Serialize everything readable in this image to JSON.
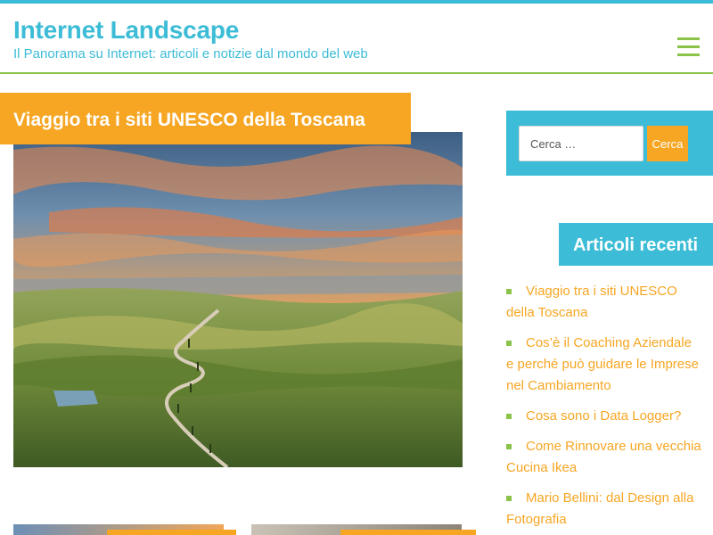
{
  "colors": {
    "accent_blue": "#3cbcd6",
    "accent_orange": "#f6a623",
    "accent_green": "#8bc34a"
  },
  "header": {
    "site_title": "Internet Landscape",
    "site_description": "Il Panorama su Internet: articoli e notizie dal mondo del web",
    "menu_icon": "hamburger-menu-icon"
  },
  "main": {
    "post_title": "Viaggio tra i siti UNESCO della Toscana",
    "featured_image": "tuscany-landscape-sunset"
  },
  "sidebar": {
    "search": {
      "placeholder": "Cerca …",
      "button_label": "Cerca"
    },
    "recent": {
      "title": "Articoli recenti",
      "items": [
        {
          "label": "Viaggio tra i siti UNESCO della Toscana"
        },
        {
          "label": "Cos’è il Coaching Aziendale e perché può guidare le Imprese nel Cambiamento"
        },
        {
          "label": "Cosa sono i Data Logger?"
        },
        {
          "label": "Come Rinnovare una vecchia Cucina Ikea"
        },
        {
          "label": "Mario Bellini: dal Design alla Fotografia"
        }
      ]
    }
  }
}
